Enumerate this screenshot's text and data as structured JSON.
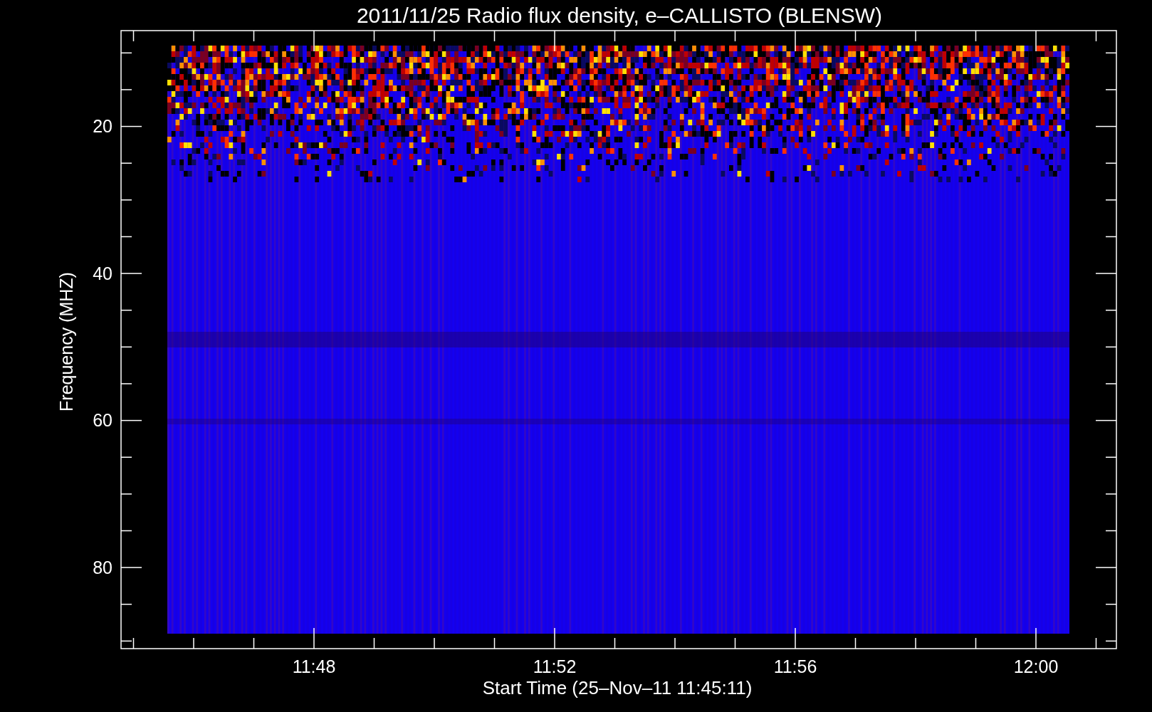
{
  "title": "2011/11/25  Radio flux density, e–CALLISTO (BLENSW)",
  "y_axis": {
    "label": "Frequency (MHZ)",
    "ticks": [
      "20",
      "40",
      "60",
      "80"
    ]
  },
  "x_axis": {
    "label": "Start Time (25–Nov–11 11:45:11)",
    "ticks": [
      "11:48",
      "11:52",
      "11:56",
      "12:00"
    ]
  }
}
